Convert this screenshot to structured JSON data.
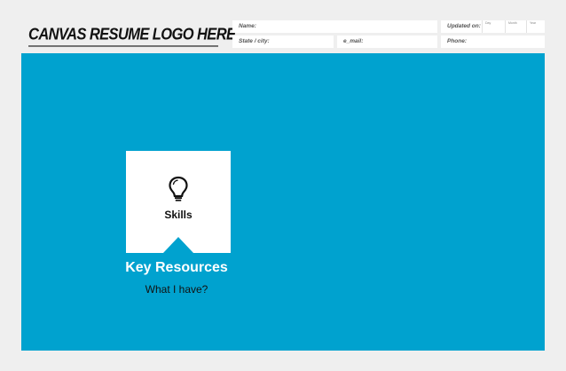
{
  "header": {
    "logo_text": "CANVAS RESUME LOGO HERE",
    "name_label": "Name:",
    "updated_label": "Updated on:",
    "day_label": "Day",
    "month_label": "Month",
    "year_label": "Year",
    "state_label": "State / city:",
    "email_label": "e_mail:",
    "phone_label": "Phone:"
  },
  "card": {
    "icon": "lightbulb-icon",
    "label": "Skills",
    "title": "Key Resources",
    "subtitle": "What I have?"
  },
  "colors": {
    "background": "#efefef",
    "canvas": "#00a2cf",
    "card": "#ffffff"
  }
}
